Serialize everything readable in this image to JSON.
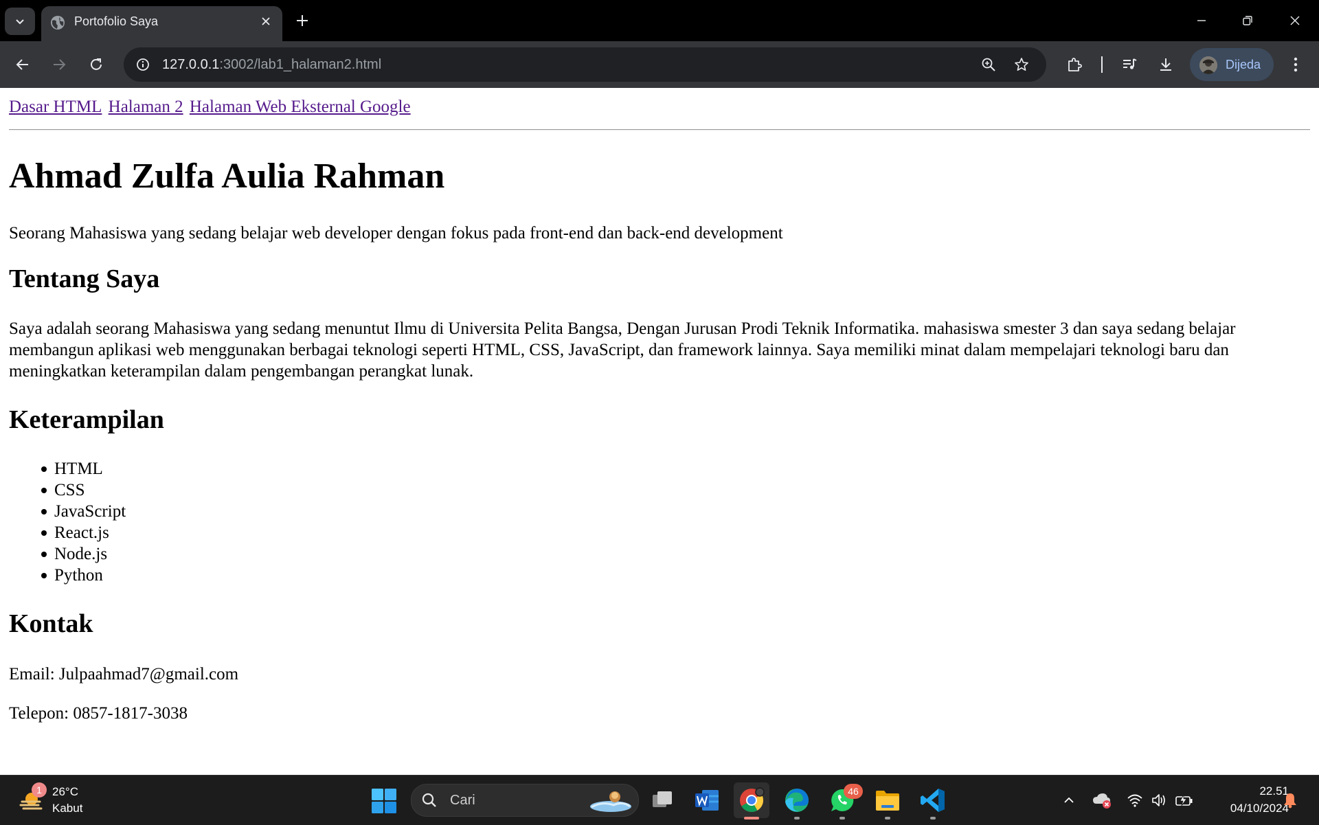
{
  "browser": {
    "tab_title": "Portofolio Saya",
    "url_host": "127.0.0.1",
    "url_rest": ":3002/lab1_halaman2.html",
    "profile_label": "Dijeda"
  },
  "page": {
    "nav_links": [
      "Dasar HTML",
      "Halaman 2",
      "Halaman Web Eksternal Google"
    ],
    "name": "Ahmad Zulfa Aulia Rahman",
    "tagline": "Seorang Mahasiswa yang sedang belajar web developer dengan fokus pada front-end dan back-end development",
    "about_heading": "Tentang Saya",
    "about_text": "Saya adalah seorang Mahasiswa yang sedang menuntut Ilmu di Universita Pelita Bangsa, Dengan Jurusan Prodi Teknik Informatika. mahasiswa smester 3 dan saya sedang belajar membangun aplikasi web menggunakan berbagai teknologi seperti HTML, CSS, JavaScript, dan framework lainnya. Saya memiliki minat dalam mempelajari teknologi baru dan meningkatkan keterampilan dalam pengembangan perangkat lunak.",
    "skills_heading": "Keterampilan",
    "skills": [
      "HTML",
      "CSS",
      "JavaScript",
      "React.js",
      "Node.js",
      "Python"
    ],
    "contact_heading": "Kontak",
    "email": "Email: Julpaahmad7@gmail.com",
    "phone": "Telepon: 0857-1817-3038"
  },
  "taskbar": {
    "weather_badge": "1",
    "weather_temp": "26°C",
    "weather_cond": "Kabut",
    "search_placeholder": "Cari",
    "whatsapp_badge": "46",
    "time": "22.51",
    "date": "04/10/2024"
  }
}
